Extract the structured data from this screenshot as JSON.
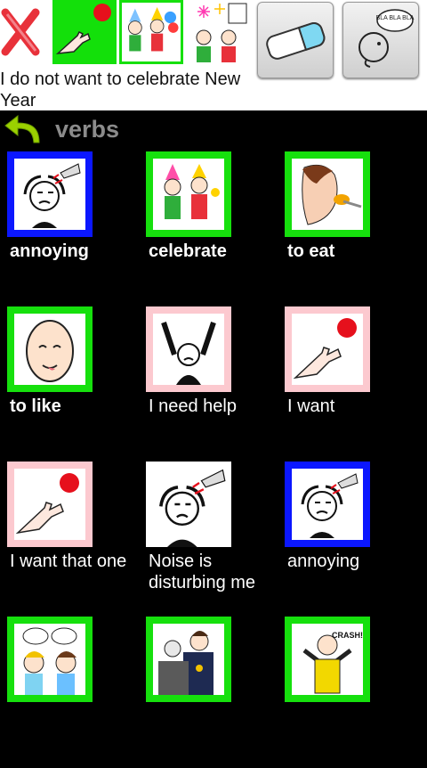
{
  "toolbar": {
    "buttons": [
      {
        "name": "delete-icon"
      },
      {
        "name": "i-want-icon"
      },
      {
        "name": "celebrate-icon"
      },
      {
        "name": "new-year-icon"
      }
    ],
    "sentence": "I do not want to celebrate New Year",
    "eraser_icon": "eraser-icon",
    "speak_icon": "speak-icon",
    "speak_text": "BLA BLA BLA"
  },
  "header": {
    "back_icon": "back-arrow-icon",
    "title": "verbs"
  },
  "grid": [
    {
      "label": "annoying",
      "border": "blue",
      "bold": true,
      "icon": "annoying-icon"
    },
    {
      "label": "celebrate",
      "border": "green",
      "bold": true,
      "icon": "celebrate-icon"
    },
    {
      "label": "to eat",
      "border": "green",
      "bold": true,
      "icon": "eat-icon"
    },
    {
      "label": "to like",
      "border": "green",
      "bold": true,
      "icon": "like-icon"
    },
    {
      "label": "I need help",
      "border": "pink",
      "bold": false,
      "icon": "help-icon"
    },
    {
      "label": "I want",
      "border": "pink",
      "bold": false,
      "icon": "want-icon"
    },
    {
      "label": "I want that one",
      "border": "pink",
      "bold": false,
      "icon": "want-that-one-icon"
    },
    {
      "label": "Noise is disturbing me",
      "border": "white",
      "bold": false,
      "icon": "noise-icon"
    },
    {
      "label": "annoying",
      "border": "blue",
      "bold": false,
      "icon": "annoying-icon"
    },
    {
      "label": "",
      "border": "green",
      "bold": true,
      "icon": "argue-icon"
    },
    {
      "label": "",
      "border": "green",
      "bold": true,
      "icon": "congratulate-icon"
    },
    {
      "label": "",
      "border": "green",
      "bold": true,
      "icon": "crash-icon",
      "pic_text": "CRASH!!"
    }
  ],
  "colors": {
    "blue": "#0b17ff",
    "green": "#16e00d",
    "pink": "#fcc9cf",
    "header_text": "#8b8b8b"
  }
}
